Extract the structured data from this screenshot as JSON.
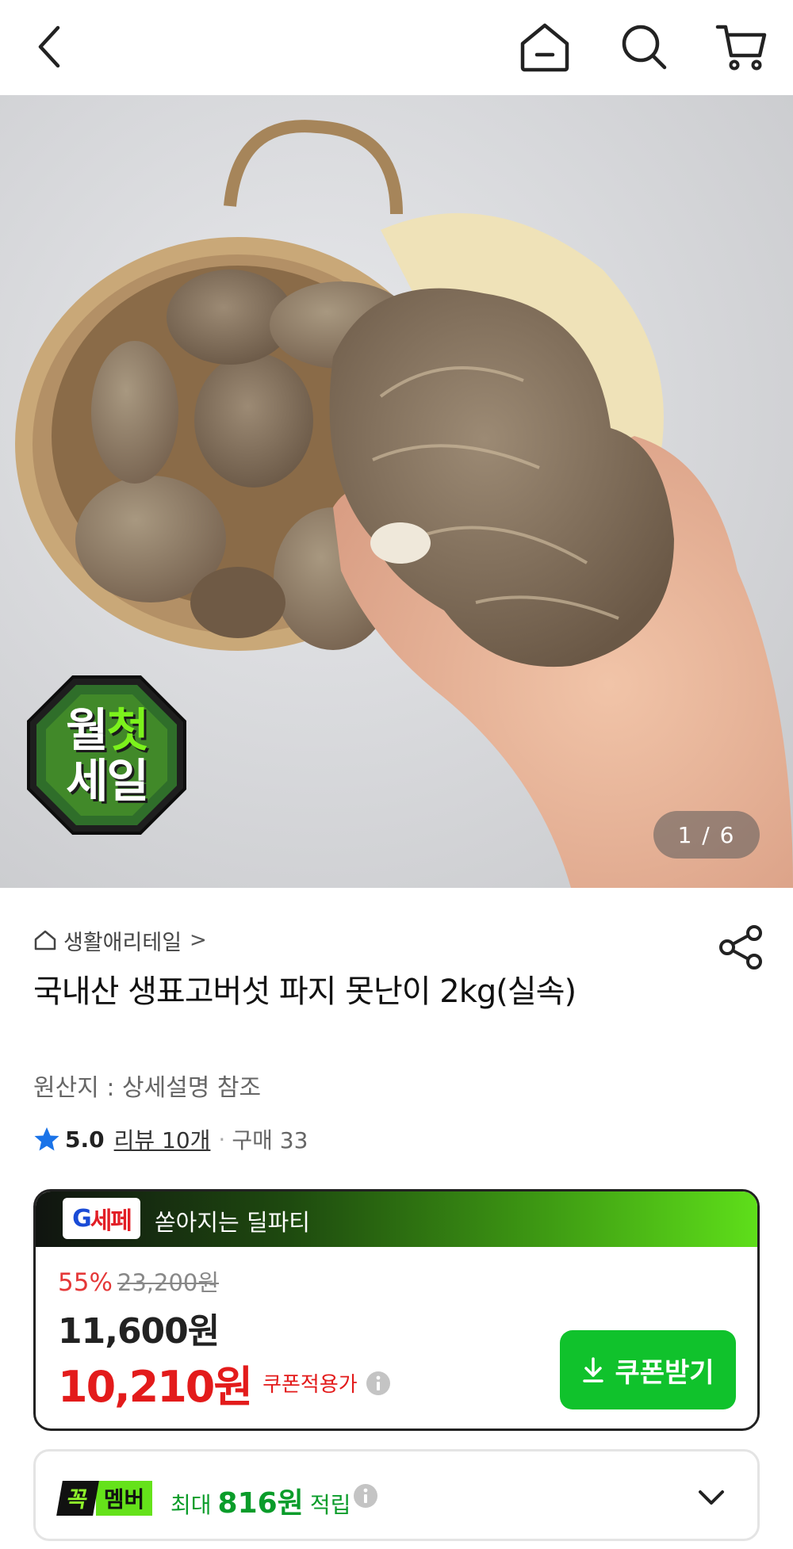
{
  "header": {
    "back_icon": "chevron-left-icon",
    "home_icon": "home-icon",
    "search_icon": "search-icon",
    "cart_icon": "cart-icon"
  },
  "gallery": {
    "badge_line1_a": "월",
    "badge_line1_b": "첫",
    "badge_line2": "세일",
    "pager": "1 / 6"
  },
  "product": {
    "store_name": "생활애리테일",
    "store_chevron": ">",
    "title": "국내산 생표고버섯 파지 못난이 2kg(실속)",
    "origin": "원산지 : 상세설명 참조",
    "rating": {
      "score": "5.0",
      "review_link": "리뷰 10개",
      "separator": "·",
      "purchases": "구매 33"
    }
  },
  "price_card": {
    "badge": {
      "g": "G",
      "rest": "세페"
    },
    "deal_text": "쏟아지는 딜파티",
    "discount_pct": "55%",
    "original_price": "23,200원",
    "sale_price": "11,600원",
    "coupon_price": "10,210원",
    "coupon_label": "쿠폰적용가",
    "coupon_button": "쿠폰받기"
  },
  "membership": {
    "badge_a": "꼭",
    "badge_b": "멤버",
    "prefix": "최대",
    "amount": "816원",
    "suffix": "적립"
  },
  "colors": {
    "accent_green": "#10c22c",
    "sale_red": "#e31b1b",
    "rating_blue": "#1a73e8"
  }
}
